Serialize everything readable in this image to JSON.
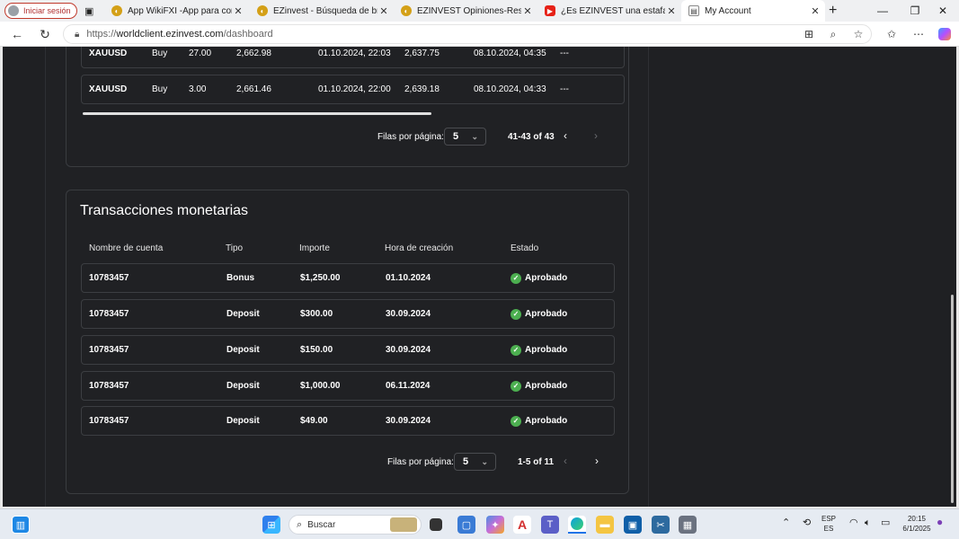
{
  "browser": {
    "profile_label": "Iniciar sesión",
    "tabs": [
      {
        "title": "App WikiFXI -App para consulta",
        "active": false
      },
      {
        "title": "EZinvest - Búsqueda de bróker c",
        "active": false
      },
      {
        "title": "EZINVEST Opiniones-Reseñas d",
        "active": false
      },
      {
        "title": "¿Es EZINVEST una estafa? Invers",
        "active": false
      },
      {
        "title": "My Account",
        "active": true
      }
    ],
    "url_prefix": "https://",
    "url_host": "worldclient.ezinvest.com",
    "url_path": "/dashboard"
  },
  "trades": {
    "rows": [
      {
        "symbol": "XAUUSD",
        "side": "Buy",
        "volume": "27.00",
        "open_price": "2,662.98",
        "open_time": "01.10.2024, 22:03",
        "close_price": "2,637.75",
        "close_time": "08.10.2024, 04:35",
        "extra": "---"
      },
      {
        "symbol": "XAUUSD",
        "side": "Buy",
        "volume": "3.00",
        "open_price": "2,661.46",
        "open_time": "01.10.2024, 22:00",
        "close_price": "2,639.18",
        "close_time": "08.10.2024, 04:33",
        "extra": "---"
      }
    ],
    "rows_per_page_label": "Filas por página:",
    "rows_per_page": "5",
    "range": "41-43 of 43"
  },
  "transactions": {
    "title": "Transacciones monetarias",
    "headers": {
      "account": "Nombre de cuenta",
      "type": "Tipo",
      "amount": "Importe",
      "created": "Hora de creación",
      "status": "Estado"
    },
    "rows": [
      {
        "account": "10783457",
        "type": "Bonus",
        "amount": "$1,250.00",
        "created": "01.10.2024",
        "status": "Aprobado"
      },
      {
        "account": "10783457",
        "type": "Deposit",
        "amount": "$300.00",
        "created": "30.09.2024",
        "status": "Aprobado"
      },
      {
        "account": "10783457",
        "type": "Deposit",
        "amount": "$150.00",
        "created": "30.09.2024",
        "status": "Aprobado"
      },
      {
        "account": "10783457",
        "type": "Deposit",
        "amount": "$1,000.00",
        "created": "06.11.2024",
        "status": "Aprobado"
      },
      {
        "account": "10783457",
        "type": "Deposit",
        "amount": "$49.00",
        "created": "30.09.2024",
        "status": "Aprobado"
      }
    ],
    "rows_per_page_label": "Filas por página:",
    "rows_per_page": "5",
    "range": "1-5 of 11"
  },
  "taskbar": {
    "search_placeholder": "Buscar",
    "lang_top": "ESP",
    "lang_bottom": "ES",
    "time": "20:15",
    "date": "6/1/2025"
  },
  "colors": {
    "accent_green": "#4caf50",
    "page_bg": "#202124",
    "profile_red": "#c0392b"
  }
}
